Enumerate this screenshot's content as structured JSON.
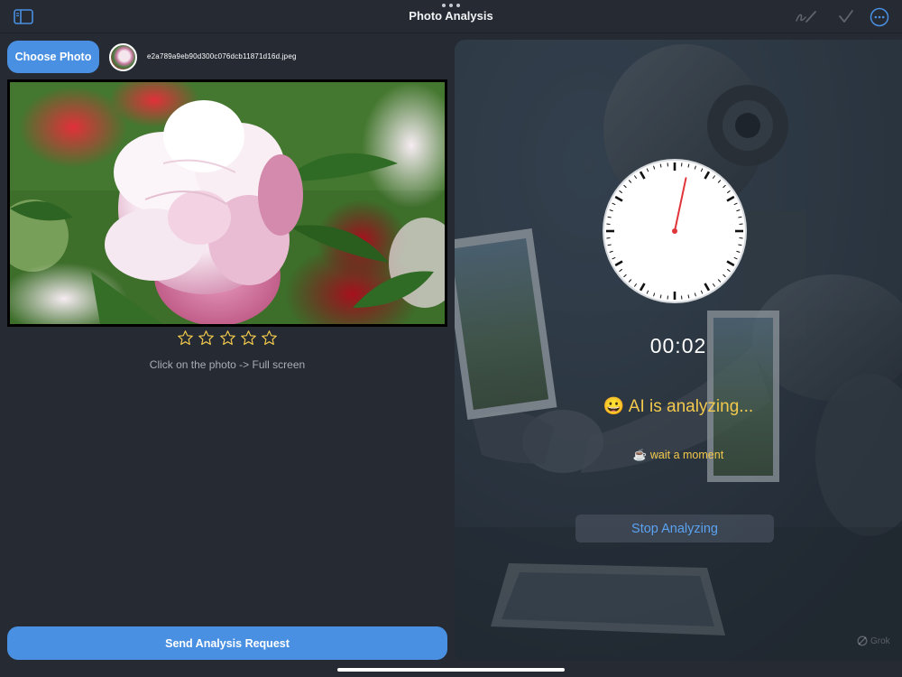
{
  "window": {
    "title": "Photo Analysis"
  },
  "icons": {
    "sidebar": "sidebar-icon",
    "markup": "markup-icon",
    "check": "checkmark-icon",
    "more": "more-icon"
  },
  "left_panel": {
    "choose_label": "Choose Photo",
    "filename": "e2a789a9eb90d300c076dcb11871d16d.jpeg",
    "rating": {
      "value": 0,
      "max": 5,
      "star_glyph": "☆"
    },
    "hint": "Click on the photo -> Full screen",
    "send_label": "Send Analysis Request"
  },
  "analysis": {
    "timer": "00:02",
    "status_emoji": "😀",
    "status": "AI is analyzing...",
    "wait_emoji": "☕",
    "wait": "wait a moment",
    "stop_label": "Stop Analyzing",
    "watermark": "Grok",
    "clock_seconds": 2
  },
  "colors": {
    "accent": "#4a90e2",
    "status": "#f2c94c",
    "stop_text": "#5ba3f0",
    "background": "#252a33",
    "clock_hand": "#e0353a"
  }
}
